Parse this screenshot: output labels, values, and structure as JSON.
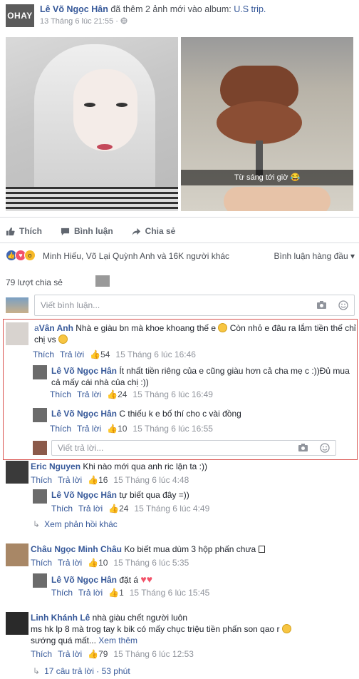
{
  "post": {
    "author": "Lê Võ Ngọc Hân",
    "action": "đã thêm 2 ảnh mới vào album:",
    "album": "U.S trip.",
    "timestamp": "13 Tháng 6 lúc 21:55",
    "privacy_icon": "globe-icon",
    "watermark": "OHAY",
    "photo_caption": "Từ sáng tới giờ 😂"
  },
  "actions": {
    "like": "Thích",
    "comment": "Bình luận",
    "share": "Chia sẻ"
  },
  "reactions": {
    "text": "Minh Hiếu, Võ Lại Quỳnh Anh và 16K người khác",
    "sort_label": "Bình luận hàng đầu",
    "shares": "79 lượt chia sẻ"
  },
  "composer": {
    "placeholder": "Viết bình luận...",
    "reply_placeholder": "Viết trả lời..."
  },
  "labels": {
    "like": "Thích",
    "reply": "Trả lời",
    "see_more": "Xem thêm"
  },
  "comments": [
    {
      "author": "Vân Anh",
      "author_prefix": "a",
      "text": "Nhà e giàu bn mà khoe khoang thế e",
      "text2": "Còn nhỏ e đâu ra lắm tiền thế chỉ chị vs",
      "likes": "54",
      "time": "15 Tháng 6 lúc 16:46"
    },
    {
      "author": "Lê Võ Ngọc Hân",
      "text": "Ít nhất tiền riêng của e cũng giàu hơn cả cha mẹ c :))Đủ mua cả mấy cái nhà của chị :))",
      "likes": "24",
      "time": "15 Tháng 6 lúc 16:49"
    },
    {
      "author": "Lê Võ Ngọc Hân",
      "text": "C thiếu k e bố thí cho c vài đồng",
      "likes": "10",
      "time": "15 Tháng 6 lúc 16:55"
    },
    {
      "author": "Eric Nguyen",
      "text": "Khi nào mới qua anh ric lận ta :))",
      "likes": "16",
      "time": "15 Tháng 6 lúc 4:48"
    },
    {
      "author": "Lê Võ Ngọc Hân",
      "text": "tự biết qua đây =))",
      "likes": "24",
      "time": "15 Tháng 6 lúc 4:49"
    },
    {
      "author": "Châu Ngọc Minh Châu",
      "text": "Ko biết mua dùm 3 hộp phấn chưa",
      "likes": "10",
      "time": "15 Tháng 6 lúc 5:35"
    },
    {
      "author": "Lê Võ Ngọc Hân",
      "text": "đặt á",
      "likes": "1",
      "time": "15 Tháng 6 lúc 15:45"
    },
    {
      "author": "Linh Khánh Lê",
      "text": "nhà giàu chết người luôn",
      "text2": "ms hk lp 8 mà trog tay k bik có mấy chục triệu tiền phấn son qao r",
      "text3": "sướng quá mất...",
      "likes": "79",
      "time": "15 Tháng 6 lúc 12:53"
    }
  ],
  "more_replies_eric": "Xem phản hồi khác",
  "more_replies_linh": "17 câu trả lời · 53 phút"
}
